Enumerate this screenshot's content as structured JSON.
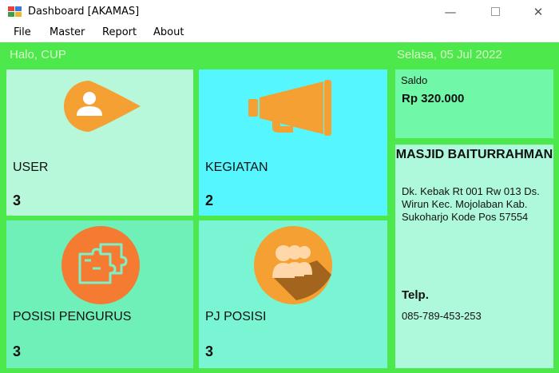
{
  "window": {
    "title": "Dashboard [AKAMAS]",
    "minimize_glyph": "—",
    "close_glyph": "✕"
  },
  "menu": [
    "File",
    "Master",
    "Report",
    "About"
  ],
  "header": {
    "greeting": "Halo, CUP",
    "date": "Selasa, 05 Jul 2022"
  },
  "tiles": {
    "user": {
      "label": "USER",
      "count": "3",
      "icon": "user-icon"
    },
    "kegiatan": {
      "label": "KEGIATAN",
      "count": "2",
      "icon": "megaphone-icon"
    },
    "posisi": {
      "label": "POSISI PENGURUS",
      "count": "3",
      "icon": "puzzle-icon"
    },
    "pj": {
      "label": "PJ POSISI",
      "count": "3",
      "icon": "group-icon"
    }
  },
  "saldo": {
    "label": "Saldo",
    "value": "Rp 320.000"
  },
  "masjid": {
    "name": "MASJID BAITURRAHMAN",
    "address": "Dk. Kebak Rt 001 Rw 013 Ds. Wirun Kec. Mojolaban Kab. Sukoharjo Kode Pos 57554",
    "telp_label": "Telp.",
    "telp_value": "085-789-453-253"
  },
  "colors": {
    "background": "#4ce84c",
    "icon_orange": "#f5a032",
    "tile_user": "#b7f8da",
    "tile_kegiatan": "#56f6ff",
    "tile_posisi": "#6ef0b8",
    "tile_pj": "#7af5d4"
  }
}
